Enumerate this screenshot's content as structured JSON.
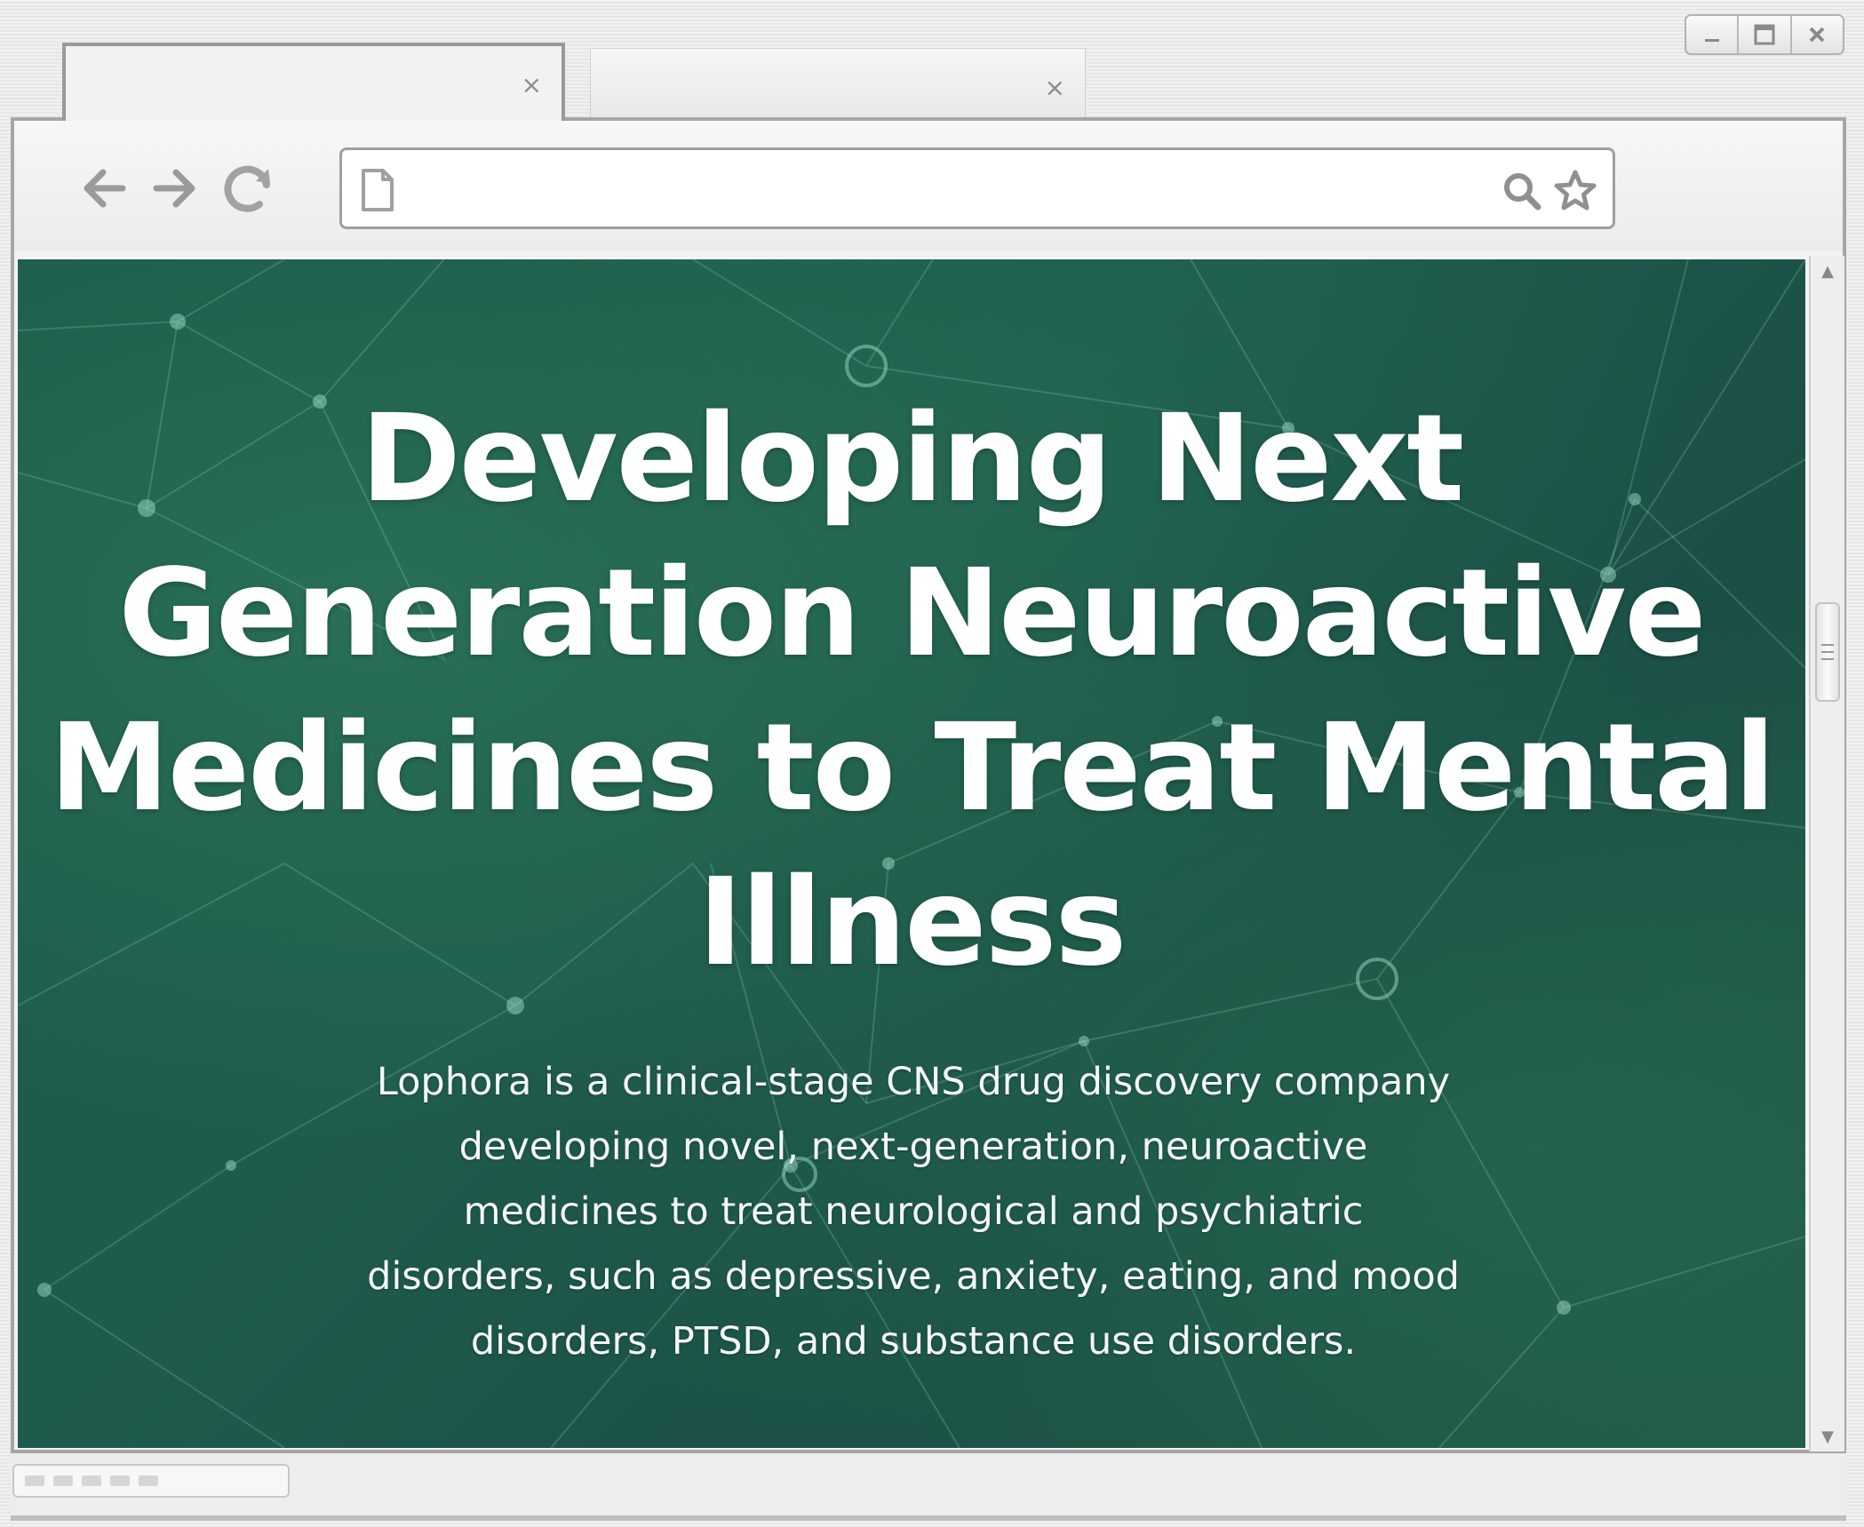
{
  "browser": {
    "tabs": [
      {
        "label": "",
        "close": "×",
        "active": true
      },
      {
        "label": "",
        "close": "×",
        "active": false
      }
    ],
    "address": {
      "value": "",
      "placeholder": ""
    },
    "window_controls": {
      "minimize": "minimize-icon",
      "maximize": "maximize-icon",
      "close": "close-icon"
    },
    "nav_icons": [
      "back-arrow-icon",
      "forward-arrow-icon",
      "reload-icon"
    ]
  },
  "hero": {
    "headline_lines": [
      "Developing Next",
      "Generation Neuroactive",
      "Medicines to Treat Mental",
      "Illness"
    ],
    "lede_lines": [
      "Lophora is a clinical-stage CNS drug discovery company",
      "developing novel, next-generation, neuroactive",
      "medicines to treat neurological and psychiatric",
      "disorders, such as depressive, anxiety, eating, and mood",
      "disorders, PTSD, and substance use disorders."
    ]
  },
  "colors": {
    "hero_background": "#1e5a4b",
    "hero_text": "#ffffff",
    "chrome_border": "#9f9f9f"
  }
}
